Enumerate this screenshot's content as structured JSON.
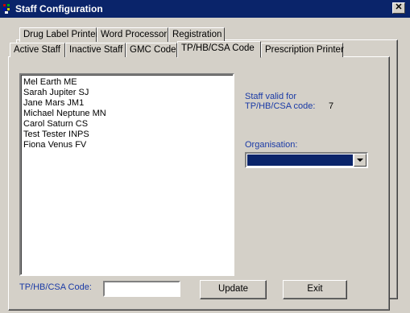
{
  "window": {
    "title": "Staff Configuration",
    "close_glyph": "✕"
  },
  "tabs_back": [
    {
      "label": "Drug Label Printer"
    },
    {
      "label": "Word Processor"
    },
    {
      "label": "Registration"
    }
  ],
  "tabs_front": [
    {
      "label": "Active Staff"
    },
    {
      "label": "Inactive Staff"
    },
    {
      "label": "GMC Code"
    },
    {
      "label": "TP/HB/CSA Code",
      "active": true
    },
    {
      "label": "Prescription Printer"
    }
  ],
  "staff_list": [
    "Mel Earth ME",
    "Sarah Jupiter SJ",
    "Jane Mars JM1",
    "Michael Neptune MN",
    "Carol Saturn CS",
    "Test Tester INPS",
    "Fiona Venus FV"
  ],
  "info": {
    "line1": "Staff valid for",
    "line2": "TP/HB/CSA code:",
    "code_value": "7"
  },
  "organisation": {
    "label": "Organisation:",
    "selected": ""
  },
  "code_field": {
    "label": "TP/HB/CSA Code:",
    "value": ""
  },
  "buttons": {
    "update": "Update",
    "exit": "Exit"
  },
  "colors": {
    "titlebar": "#0a246a",
    "label_blue": "#1a3aa6",
    "face": "#d4d0c8"
  }
}
